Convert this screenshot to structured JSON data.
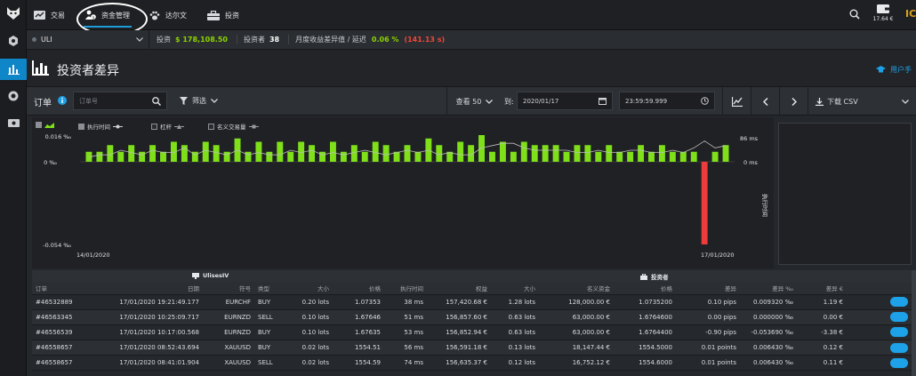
{
  "nav": {
    "items": [
      {
        "label": "交易",
        "icon": "trade-icon"
      },
      {
        "label": "资金管理",
        "icon": "money-manager-icon"
      },
      {
        "label": "达尔文",
        "icon": "paw-icon"
      },
      {
        "label": "投资",
        "icon": "briefcase-icon"
      }
    ],
    "wallet_amount": "17.64 €",
    "brand_fragment": "IC"
  },
  "account": {
    "name": "ULI",
    "invest_label": "投资",
    "invest_value": "$ 178,108.50",
    "investors_label": "投资者",
    "investors_value": "38",
    "divergence_label": "月度收益差异值 / 延迟",
    "divergence_pct": "0.06 %",
    "divergence_ms": "(141.13 s)"
  },
  "page": {
    "title": "投资者差异",
    "user_manual": "用户手"
  },
  "filters": {
    "orders_label": "订单",
    "order_placeholder": "订单号",
    "filter_label": "筛选",
    "view_label": "查看 50",
    "to_label": "到:",
    "date_value": "2020/01/17",
    "time_value": "23:59:59.999",
    "download_label": "下载 CSV"
  },
  "chart_data": {
    "type": "bar",
    "legend": [
      {
        "label": "执行时间",
        "checked": true
      },
      {
        "label": "杠杆",
        "checked": false
      },
      {
        "label": "名义交易量",
        "checked": false
      }
    ],
    "y_left_ticks": [
      "0.016 ‰",
      "0 ‰",
      "-0.054 ‰"
    ],
    "y_right_ticks": [
      "86 ms",
      "0 ms"
    ],
    "y_right_label": "执行时间",
    "x_labels": [
      "14/01/2020",
      "17/01/2020"
    ],
    "ylim": [
      -0.054,
      0.016
    ],
    "bars": [
      0.006,
      0.006,
      0.01,
      0.006,
      0.01,
      0.006,
      0.01,
      0.006,
      0.012,
      0.01,
      0.006,
      0.012,
      0.01,
      0.006,
      0.014,
      0.006,
      0.012,
      0.006,
      0.012,
      0.006,
      0.012,
      0.01,
      0.006,
      0.012,
      0.006,
      0.01,
      0.006,
      0.012,
      0.01,
      0.006,
      0.01,
      0.006,
      0.014,
      0.01,
      0.006,
      0.012,
      0.01,
      0.016,
      0.006,
      0.012,
      0.006,
      0.012,
      0.01,
      0.01,
      0.01,
      0.006,
      0.01,
      0.01,
      0.006,
      0.01,
      0.006,
      0.006,
      0.01,
      0.006,
      0.01,
      0.006,
      0.006,
      0.006,
      -0.054,
      0.006,
      0.01
    ],
    "highlight_bar_index": 58,
    "line": [
      0.2,
      0.3,
      0.3,
      0.5,
      0.4,
      0.3,
      0.5,
      0.4,
      0.4,
      0.6,
      0.3,
      0.5,
      0.4,
      0.3,
      0.5,
      0.3,
      0.4,
      0.3,
      0.3,
      0.5,
      0.4,
      0.5,
      0.3,
      0.4,
      0.3,
      0.4,
      0.5,
      0.4,
      0.3,
      0.4,
      0.5,
      0.4,
      0.5,
      0.3,
      0.4,
      0.3,
      0.3,
      0.6,
      0.7,
      0.8,
      0.8,
      0.6,
      0.5,
      0.5,
      0.5,
      0.5,
      0.4,
      0.4,
      0.5,
      0.4,
      0.4,
      0.5,
      0.5,
      0.4,
      0.4,
      0.5,
      0.4,
      0.6,
      0.9,
      0.6,
      0.7
    ],
    "colors": {
      "bar": "#7fe01a",
      "bar_negative": "#ee3b3b",
      "line": "#bdbdbd"
    }
  },
  "table": {
    "groups": {
      "left": "UlisesIV",
      "right": "投资者"
    },
    "headers": [
      "订单",
      "日期",
      "符号",
      "类型",
      "大小",
      "价格",
      "执行时间",
      "权益",
      "大小",
      "名义资金",
      "价格",
      "差异",
      "差异 ‰",
      "差异 €",
      ""
    ],
    "rows": [
      [
        "#46532889",
        "17/01/2020 19:21:49.177",
        "EURCHF",
        "BUY",
        "0.20 lots",
        "1.07353",
        "38 ms",
        "157,420.68 €",
        "1.28 lots",
        "128,000.00 €",
        "1.0735200",
        "0.10 pips",
        "0.009320 ‰",
        "1.19 €"
      ],
      [
        "#46563345",
        "17/01/2020 10:25:09.717",
        "EURNZD",
        "SELL",
        "0.10 lots",
        "1.67646",
        "51 ms",
        "156,857.60 €",
        "0.63 lots",
        "63,000.00 €",
        "1.6764600",
        "0.00 pips",
        "0.000000 ‰",
        "0.00 €"
      ],
      [
        "#46556539",
        "17/01/2020 10:17:00.568",
        "EURNZD",
        "BUY",
        "0.10 lots",
        "1.67635",
        "53 ms",
        "156,852.94 €",
        "0.63 lots",
        "63,000.00 €",
        "1.6764400",
        "-0.90 pips",
        "-0.053690 ‰",
        "-3.38 €"
      ],
      [
        "#46558657",
        "17/01/2020 08:52:43.694",
        "XAUUSD",
        "BUY",
        "0.02 lots",
        "1554.51",
        "56 ms",
        "156,591.18 €",
        "0.13 lots",
        "18,147.44 €",
        "1554.5000",
        "0.01 points",
        "0.006430 ‰",
        "0.12 €"
      ],
      [
        "#46558657",
        "17/01/2020 08:41:01.904",
        "XAUUSD",
        "SELL",
        "0.02 lots",
        "1554.59",
        "74 ms",
        "156,635.37 €",
        "0.12 lots",
        "16,752.12 €",
        "1554.6000",
        "0.01 points",
        "0.006430 ‰",
        "0.11 €"
      ]
    ],
    "row_status": [
      "pos",
      "zero",
      "neg",
      "pos",
      "pos"
    ]
  }
}
